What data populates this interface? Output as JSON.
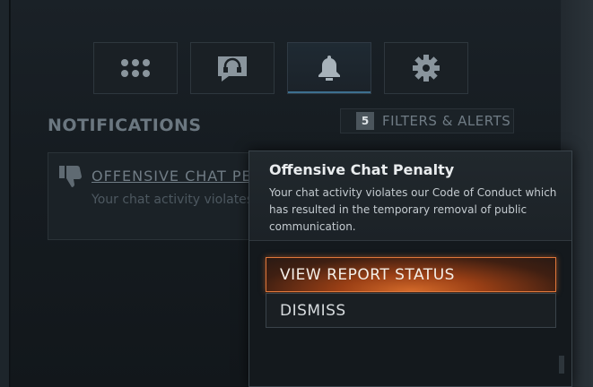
{
  "tabs": [
    {
      "name": "grid",
      "icon": "grid-icon",
      "active": false
    },
    {
      "name": "voice",
      "icon": "headset-icon",
      "active": false
    },
    {
      "name": "notifications",
      "icon": "bell-icon",
      "active": true
    },
    {
      "name": "settings",
      "icon": "gear-icon",
      "active": false
    }
  ],
  "header": {
    "title": "NOTIFICATIONS"
  },
  "filters": {
    "count": "5",
    "label": "FILTERS & ALERTS"
  },
  "notification": {
    "title": "OFFENSIVE CHAT PENALTY",
    "subtitle": "Your chat activity violates our Code of Conduct",
    "icon": "thumbs-down-icon"
  },
  "popup": {
    "title": "Offensive Chat Penalty",
    "body": "Your chat activity violates our Code of Conduct which has resulted in the temporary removal of public communication.",
    "primary_label": "VIEW REPORT STATUS",
    "secondary_label": "DISMISS"
  },
  "colors": {
    "accent": "#e0773a",
    "panel": "#14191d"
  }
}
